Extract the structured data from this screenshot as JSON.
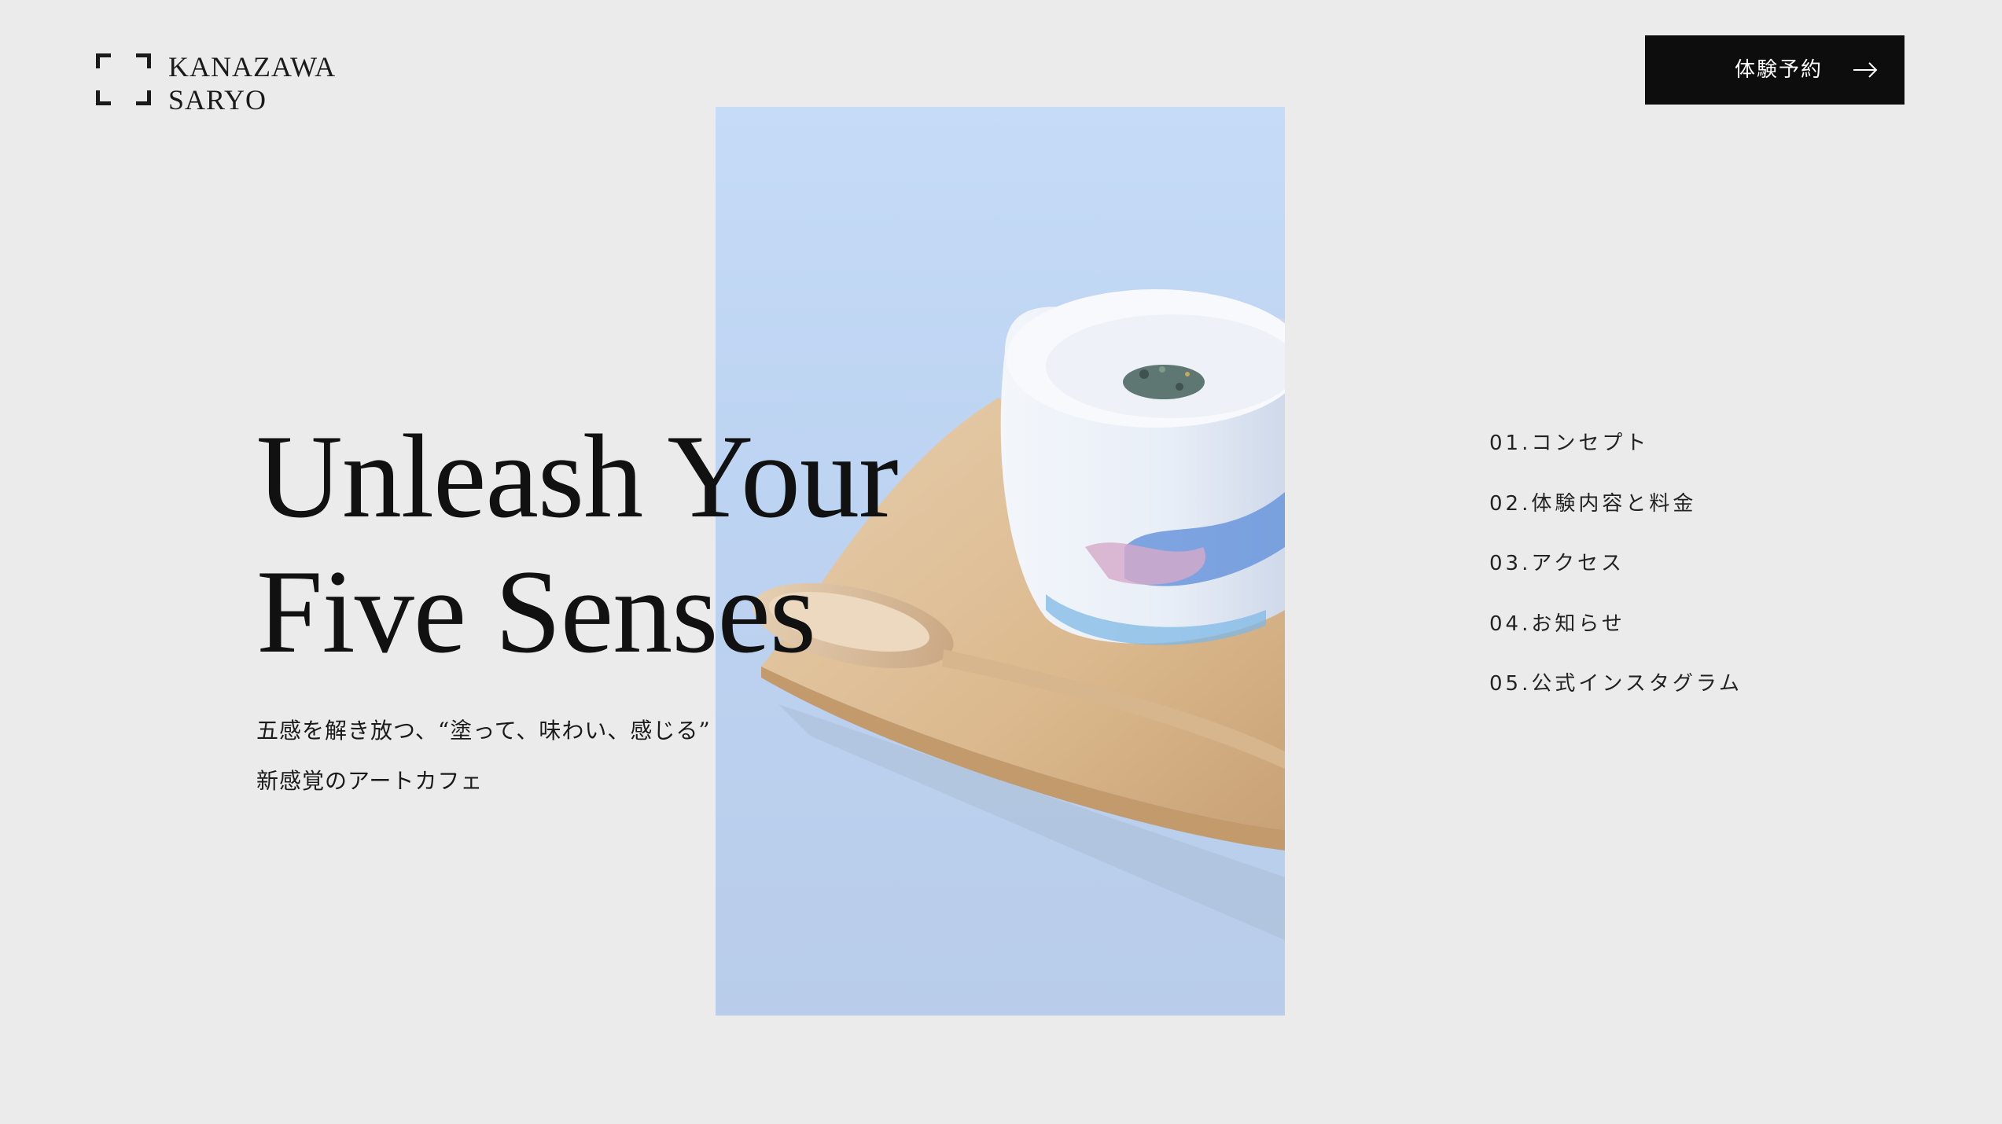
{
  "logo": {
    "line1": "KANAZAWA",
    "line2": "SARYO"
  },
  "header": {
    "reserve_label": "体験予約",
    "reserve_icon": "arrow-right-icon"
  },
  "hero": {
    "headline_line1": "Unleash Your",
    "headline_line2": "Five Senses",
    "sub_line1": "五感を解き放つ、“塗って、味わい、感じる”",
    "sub_line2": "新感覚のアートカフェ"
  },
  "nav": {
    "items": [
      {
        "label": "01.コンセプト"
      },
      {
        "label": "02.体験内容と料金"
      },
      {
        "label": "03.アクセス"
      },
      {
        "label": "04.お知らせ"
      },
      {
        "label": "05.公式インスタグラム"
      }
    ]
  },
  "colors": {
    "background": "#ebebeb",
    "button_bg": "#0d0d0d",
    "text": "#111111",
    "photo_sky": "#c7dcf6"
  }
}
